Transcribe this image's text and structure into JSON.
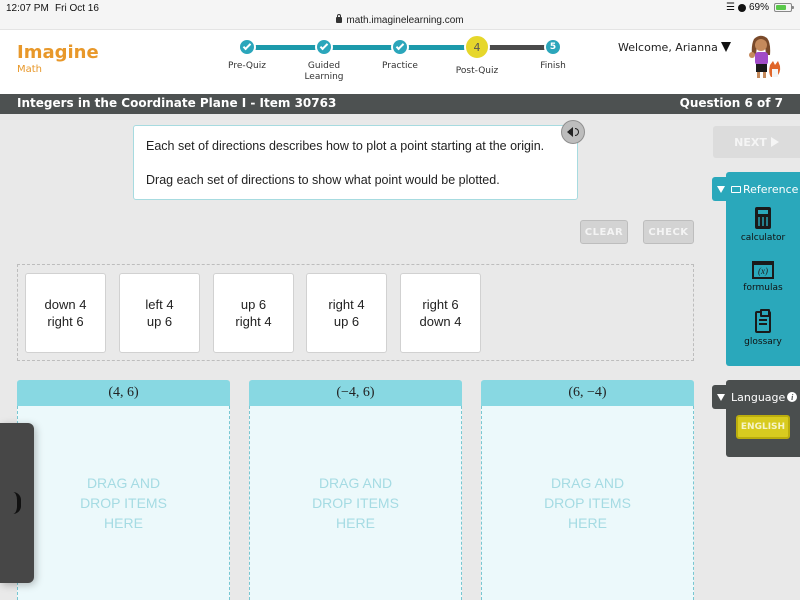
{
  "status_bar": {
    "time": "12:07 PM",
    "date": "Fri Oct 16",
    "url": "math.imaginelearning.com",
    "battery_percent_label": "69%",
    "battery_level": 0.69
  },
  "header": {
    "logo_main": "Imagine",
    "logo_sub": "Math",
    "steps": [
      {
        "label": "Pre-Quiz",
        "state": "complete"
      },
      {
        "label": "Guided Learning",
        "state": "complete"
      },
      {
        "label": "Practice",
        "state": "complete"
      },
      {
        "label": "Post-Quiz",
        "state": "current",
        "number": "4"
      },
      {
        "label": "Finish",
        "state": "pending",
        "number": "5"
      }
    ],
    "welcome": "Welcome, Arianna"
  },
  "titlebar": {
    "title": "Integers in the Coordinate Plane I - Item 30763",
    "question_counter": "Question 6 of 7"
  },
  "instructions": {
    "line1": "Each set of directions describes how to plot a point starting at the origin.",
    "line2": "Drag each set of directions to show what point would be plotted."
  },
  "buttons": {
    "clear": "CLEAR",
    "check": "CHECK",
    "next": "NEXT"
  },
  "cards": [
    {
      "line1": "down 4",
      "line2": "right 6"
    },
    {
      "line1": "left 4",
      "line2": "up 6"
    },
    {
      "line1": "up 6",
      "line2": "right 4"
    },
    {
      "line1": "right 4",
      "line2": "up 6"
    },
    {
      "line1": "right 6",
      "line2": "down 4"
    }
  ],
  "drop_zones": [
    {
      "label": "(4, 6)",
      "placeholder": "DRAG AND\nDROP ITEMS\nHERE"
    },
    {
      "label": "(−4, 6)",
      "placeholder": "DRAG AND\nDROP ITEMS\nHERE"
    },
    {
      "label": "(6, −4)",
      "placeholder": "DRAG AND\nDROP ITEMS\nHERE"
    }
  ],
  "reference": {
    "title": "Reference",
    "items": [
      {
        "label": "calculator",
        "icon": "calculator-icon"
      },
      {
        "label": "formulas",
        "icon": "formulas-icon"
      },
      {
        "label": "glossary",
        "icon": "glossary-icon"
      }
    ],
    "formula_glyph": "(x)"
  },
  "language": {
    "title": "Language",
    "selected": "ENGLISH"
  },
  "colors": {
    "brand_orange": "#e8982a",
    "teal": "#2aa8bb",
    "current_step_yellow": "#e6d72b",
    "dropzone_header": "#88d8e2",
    "titlebar": "#4d5151"
  }
}
